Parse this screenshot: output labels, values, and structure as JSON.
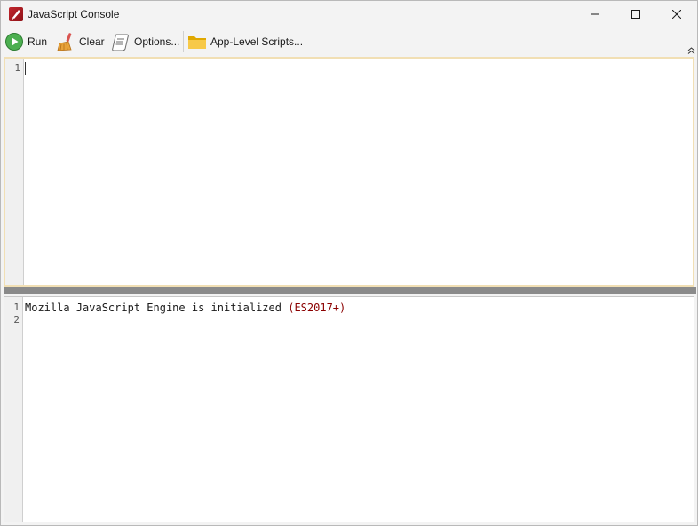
{
  "window": {
    "title": "JavaScript Console"
  },
  "toolbar": {
    "run_label": "Run",
    "clear_label": "Clear",
    "options_label": "Options...",
    "scripts_label": "App-Level Scripts..."
  },
  "input_editor": {
    "line_numbers": [
      "1"
    ],
    "lines": [
      ""
    ]
  },
  "output_console": {
    "line_numbers": [
      "1",
      "2"
    ],
    "lines": [
      {
        "text": "Mozilla JavaScript Engine is initialized ",
        "paren": "(ES2017+)"
      },
      {
        "text": "",
        "paren": ""
      }
    ]
  },
  "icons": {
    "app": "pdf-editor-icon",
    "run": "play-icon",
    "clear": "broom-icon",
    "options": "scroll-icon",
    "scripts": "folder-icon"
  },
  "colors": {
    "run_green": "#4caf50",
    "folder_yellow": "#f7c948",
    "active_border": "#f1dfb4",
    "splitter": "#8a8a8a"
  }
}
